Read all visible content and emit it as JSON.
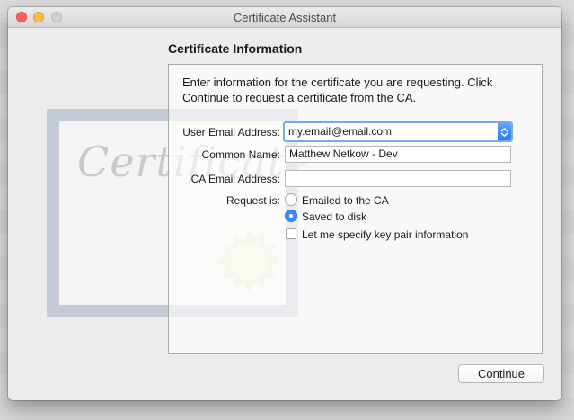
{
  "window": {
    "title": "Certificate Assistant"
  },
  "section": {
    "heading": "Certificate Information",
    "intro": "Enter information for the certificate you are requesting. Click Continue to request a certificate from the CA."
  },
  "form": {
    "user_email": {
      "label": "User Email Address:",
      "value_before_caret": "my.email",
      "value_after_caret": "@email.com"
    },
    "common_name": {
      "label": "Common Name:",
      "value": "Matthew Netkow - Dev"
    },
    "ca_email": {
      "label": "CA Email Address:",
      "value": ""
    },
    "request": {
      "label": "Request is:",
      "options": [
        {
          "label": "Emailed to the CA",
          "selected": false
        },
        {
          "label": "Saved to disk",
          "selected": true
        }
      ]
    },
    "key_pair": {
      "label": "Let me specify key pair information",
      "checked": false
    }
  },
  "footer": {
    "continue_label": "Continue"
  },
  "colors": {
    "accent": "#3b8bf5",
    "focus_ring": "#79aaf0",
    "close": "#fc605c",
    "minimize": "#fdbc40"
  },
  "icons": [
    "close-icon",
    "minimize-icon",
    "zoom-icon",
    "chevron-updown-icon",
    "certificate-illustration"
  ]
}
